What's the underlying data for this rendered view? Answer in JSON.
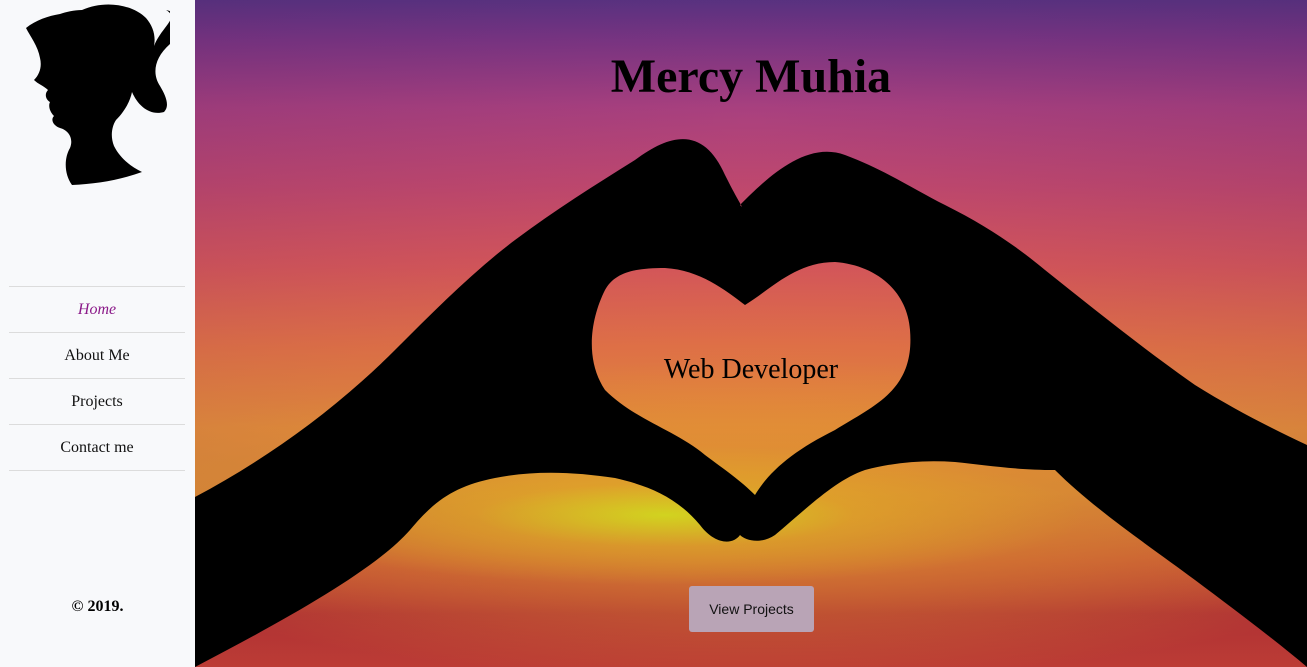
{
  "sidebar": {
    "logo_icon": "woman-silhouette-icon",
    "nav": [
      {
        "label": "Home",
        "active": true
      },
      {
        "label": "About Me",
        "active": false
      },
      {
        "label": "Projects",
        "active": false
      },
      {
        "label": "Contact me",
        "active": false
      }
    ],
    "copyright": "© 2019."
  },
  "hero": {
    "title": "Mercy Muhia",
    "subtitle": "Web Developer",
    "button_label": "View Projects",
    "background_image": "heart-hands-sunset-image"
  },
  "colors": {
    "sidebar_bg": "#f8f9fb",
    "active_nav": "#8b1a89",
    "button_bg": "#b9a4b6"
  }
}
